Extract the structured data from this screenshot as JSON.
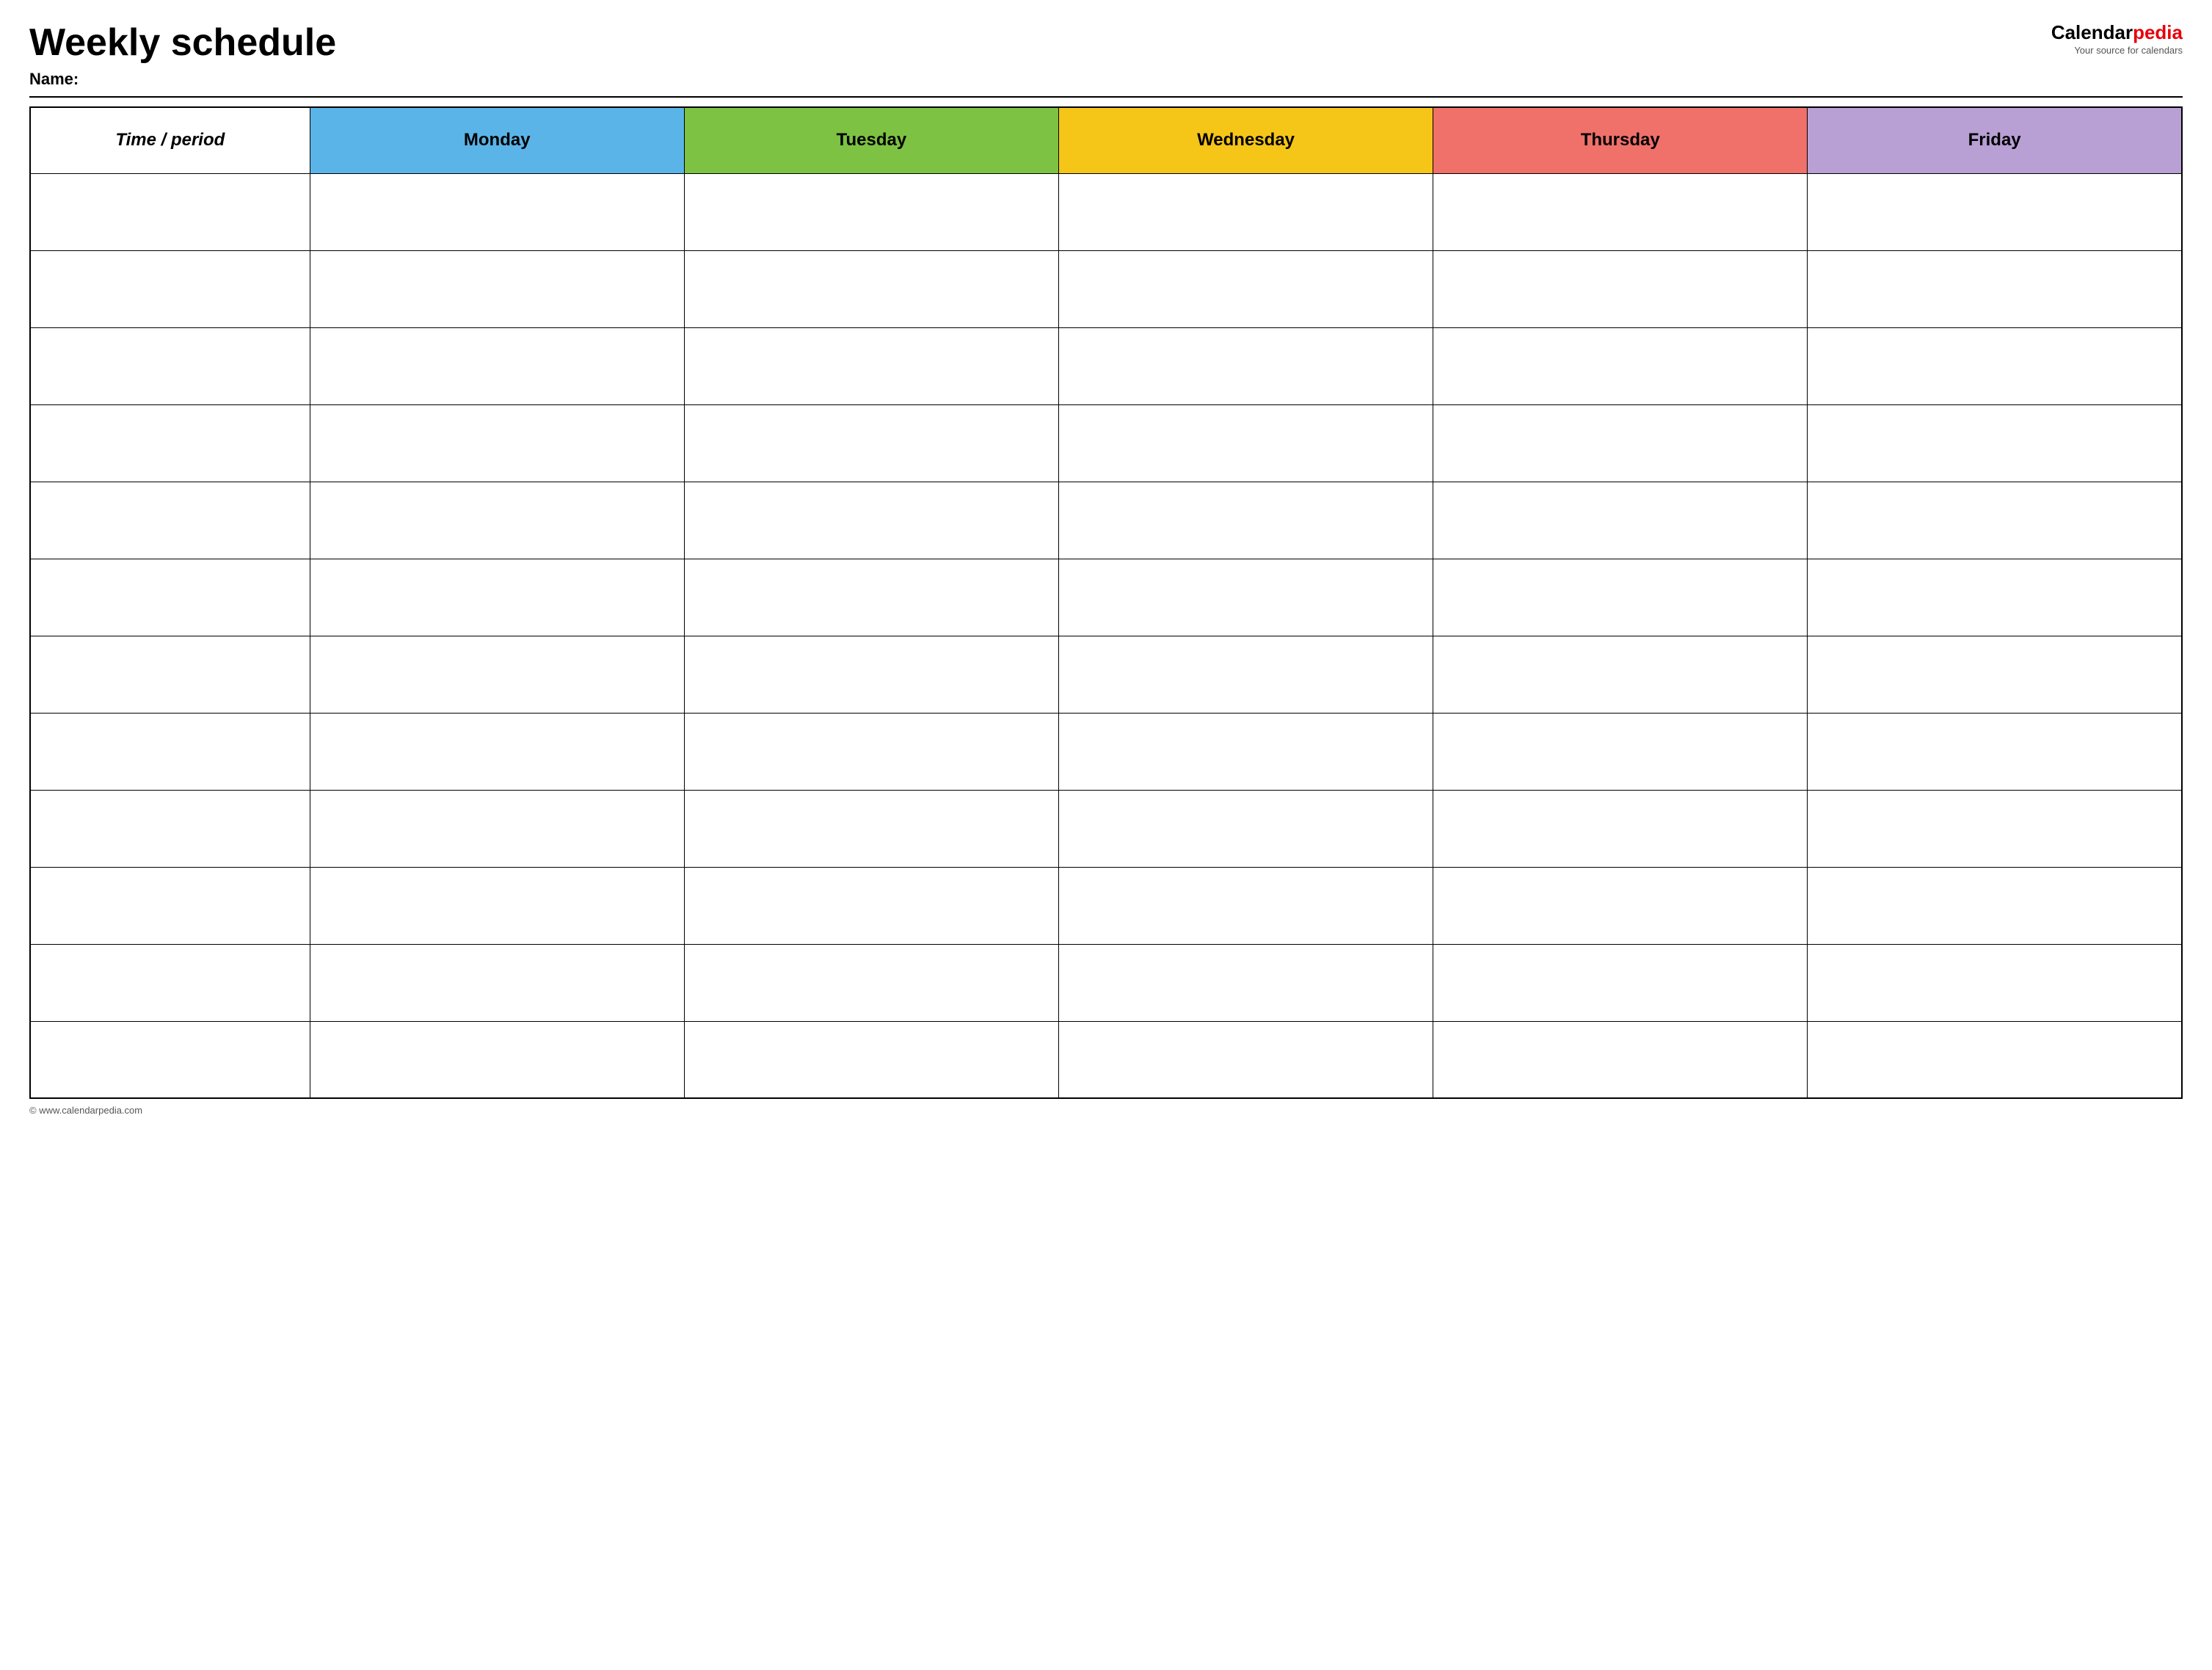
{
  "header": {
    "title": "Weekly schedule",
    "name_label": "Name:",
    "logo_calendar": "Calendar",
    "logo_pedia": "pedia",
    "logo_tagline": "Your source for calendars"
  },
  "table": {
    "columns": [
      {
        "key": "time",
        "label": "Time / period",
        "class": "th-time"
      },
      {
        "key": "monday",
        "label": "Monday",
        "class": "th-monday"
      },
      {
        "key": "tuesday",
        "label": "Tuesday",
        "class": "th-tuesday"
      },
      {
        "key": "wednesday",
        "label": "Wednesday",
        "class": "th-wednesday"
      },
      {
        "key": "thursday",
        "label": "Thursday",
        "class": "th-thursday"
      },
      {
        "key": "friday",
        "label": "Friday",
        "class": "th-friday"
      }
    ],
    "row_count": 12
  },
  "footer": {
    "url": "© www.calendarpedia.com"
  }
}
